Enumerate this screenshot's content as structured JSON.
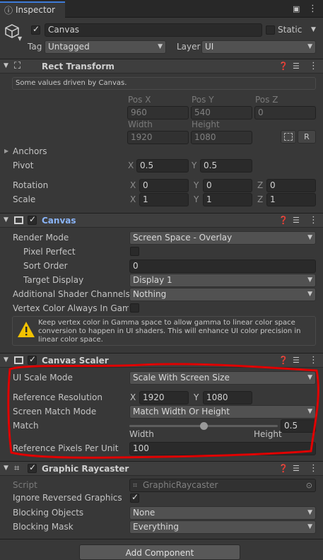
{
  "tab": {
    "title": "Inspector"
  },
  "object": {
    "name": "Canvas",
    "static_label": "Static",
    "tag_label": "Tag",
    "tag_value": "Untagged",
    "layer_label": "Layer",
    "layer_value": "UI"
  },
  "rect_transform": {
    "title": "Rect Transform",
    "notice": "Some values driven by Canvas.",
    "pos_x_label": "Pos X",
    "pos_y_label": "Pos Y",
    "pos_z_label": "Pos Z",
    "pos_x": "960",
    "pos_y": "540",
    "pos_z": "0",
    "width_label": "Width",
    "height_label": "Height",
    "width": "1920",
    "height": "1080",
    "r_button": "R",
    "anchors_label": "Anchors",
    "pivot_label": "Pivot",
    "pivot_x": "0.5",
    "pivot_y": "0.5",
    "rotation_label": "Rotation",
    "rot_x": "0",
    "rot_y": "0",
    "rot_z": "0",
    "scale_label": "Scale",
    "scale_x": "1",
    "scale_y": "1",
    "scale_z": "1",
    "x": "X",
    "y": "Y",
    "z": "Z"
  },
  "canvas": {
    "title": "Canvas",
    "render_mode_label": "Render Mode",
    "render_mode": "Screen Space - Overlay",
    "pixel_perfect_label": "Pixel Perfect",
    "sort_order_label": "Sort Order",
    "sort_order": "0",
    "target_display_label": "Target Display",
    "target_display": "Display 1",
    "shader_channels_label": "Additional Shader Channels",
    "shader_channels": "Nothing",
    "vertex_color_label": "Vertex Color Always In Gamm",
    "warning": "Keep vertex color in Gamma space to allow gamma to linear color space conversion to happen in UI shaders. This will enhance UI color precision in linear color space."
  },
  "canvas_scaler": {
    "title": "Canvas Scaler",
    "ui_scale_mode_label": "UI Scale Mode",
    "ui_scale_mode": "Scale With Screen Size",
    "ref_res_label": "Reference Resolution",
    "ref_x": "1920",
    "ref_y": "1080",
    "match_mode_label": "Screen Match Mode",
    "match_mode": "Match Width Or Height",
    "match_label": "Match",
    "match_value": "0.5",
    "match_fraction": 0.5,
    "width_caption": "Width",
    "height_caption": "Height",
    "ref_ppu_label": "Reference Pixels Per Unit",
    "ref_ppu": "100"
  },
  "graphic_raycaster": {
    "title": "Graphic Raycaster",
    "script_label": "Script",
    "script_value": "GraphicRaycaster",
    "ignore_reversed_label": "Ignore Reversed Graphics",
    "blocking_objects_label": "Blocking Objects",
    "blocking_objects": "None",
    "blocking_mask_label": "Blocking Mask",
    "blocking_mask": "Everything"
  },
  "add_component": "Add Component",
  "colors": {
    "highlight_red": "#e00000",
    "canvas_title_blue": "#8ab4f8"
  }
}
